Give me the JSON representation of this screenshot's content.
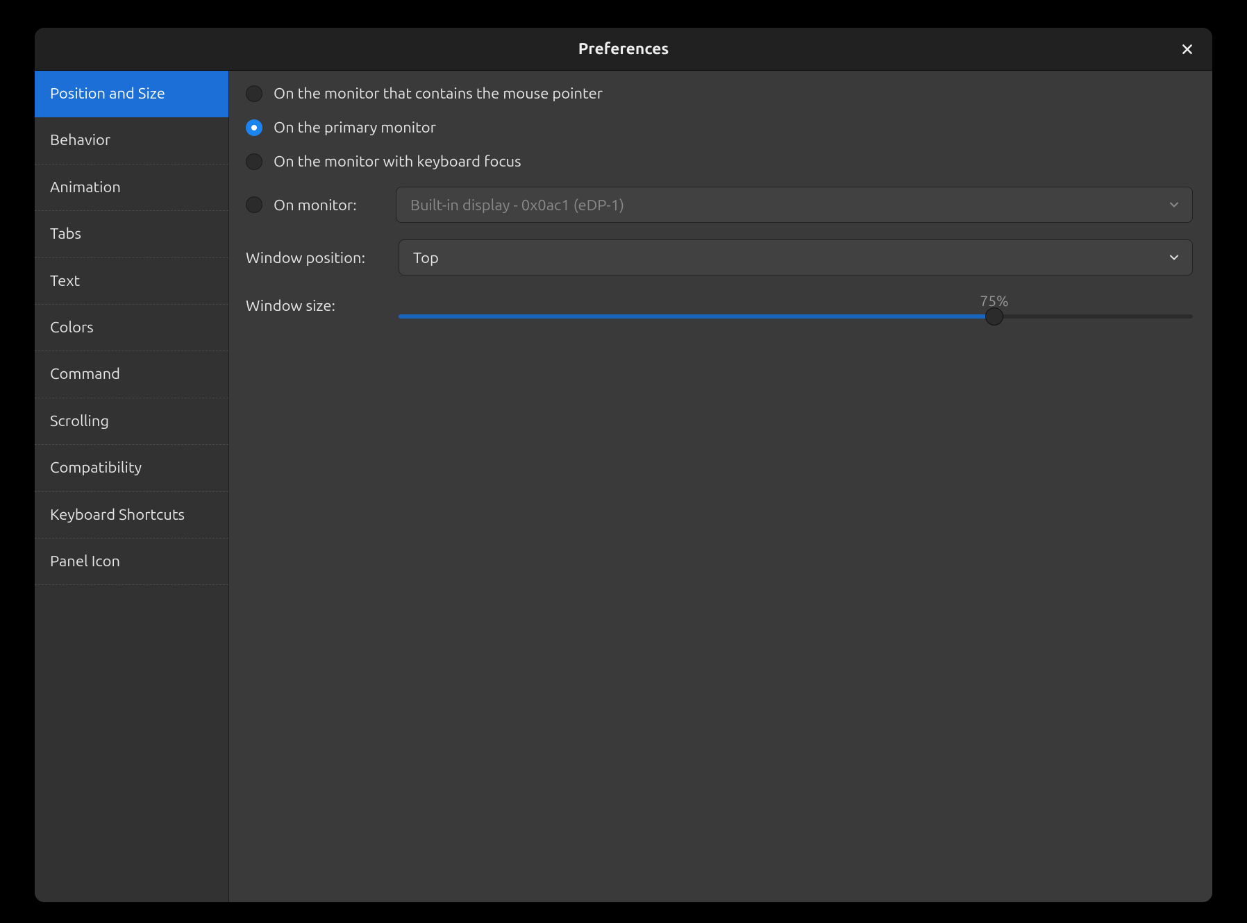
{
  "window": {
    "title": "Preferences"
  },
  "sidebar": {
    "items": [
      {
        "label": "Position and Size",
        "selected": true
      },
      {
        "label": "Behavior",
        "selected": false
      },
      {
        "label": "Animation",
        "selected": false
      },
      {
        "label": "Tabs",
        "selected": false
      },
      {
        "label": "Text",
        "selected": false
      },
      {
        "label": "Colors",
        "selected": false
      },
      {
        "label": "Command",
        "selected": false
      },
      {
        "label": "Scrolling",
        "selected": false
      },
      {
        "label": "Compatibility",
        "selected": false
      },
      {
        "label": "Keyboard Shortcuts",
        "selected": false
      },
      {
        "label": "Panel Icon",
        "selected": false
      }
    ]
  },
  "content": {
    "monitor_radios": [
      {
        "label": "On the monitor that contains the mouse pointer",
        "selected": false
      },
      {
        "label": "On the primary monitor",
        "selected": true
      },
      {
        "label": "On the monitor with keyboard focus",
        "selected": false
      }
    ],
    "on_monitor": {
      "radio_label": "On monitor:",
      "selected": false,
      "dropdown_value": "Built-in display - 0x0ac1 (eDP-1)",
      "dropdown_enabled": false
    },
    "window_position": {
      "label": "Window position:",
      "value": "Top"
    },
    "window_size": {
      "label": "Window size:",
      "percent": 75,
      "display": "75%"
    }
  },
  "colors": {
    "accent": "#1c6fd6",
    "radio_selected": "#1c84ee",
    "slider_fill": "#1865c0"
  }
}
